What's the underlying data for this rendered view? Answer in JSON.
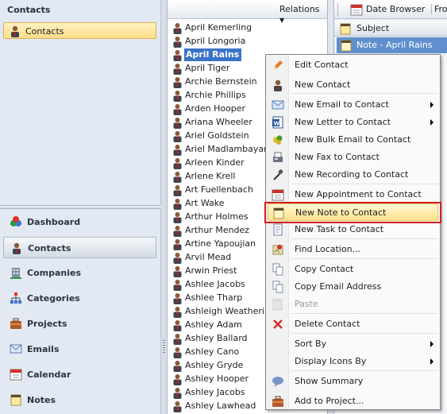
{
  "left_pane": {
    "title": "Contacts",
    "folder_label": "Contacts",
    "nav": [
      {
        "label": "Dashboard",
        "icon": "dashboard-icon"
      },
      {
        "label": "Contacts",
        "icon": "contact-icon"
      },
      {
        "label": "Companies",
        "icon": "company-icon"
      },
      {
        "label": "Categories",
        "icon": "categories-icon"
      },
      {
        "label": "Projects",
        "icon": "projects-icon"
      },
      {
        "label": "Emails",
        "icon": "email-icon"
      },
      {
        "label": "Calendar",
        "icon": "calendar-icon"
      },
      {
        "label": "Notes",
        "icon": "notes-icon"
      }
    ]
  },
  "list_pane": {
    "relations_label": "Relations",
    "contacts": [
      "April Kemerling",
      "April Longoria",
      "April Rains",
      "April Tiger",
      "Archie Bernstein",
      "Archie Phillips",
      "Arden Hooper",
      "Ariana Wheeler",
      "Ariel Goldstein",
      "Ariel Madlambayan",
      "Arleen Kinder",
      "Arlene Krell",
      "Art Fuellenbach",
      "Art Wake",
      "Arthur Holmes",
      "Arthur Mendez",
      "Artine Yapoujian",
      "Arvil Mead",
      "Arwin Priest",
      "Ashlee Jacobs",
      "Ashlee Tharp",
      "Ashleigh Weatherill",
      "Ashley Adam",
      "Ashley Ballard",
      "Ashley Cano",
      "Ashley Gryde",
      "Ashley Hooper",
      "Ashley Jacobs",
      "Ashley Lawhead"
    ],
    "selected_contact": "April Rains"
  },
  "right_pane": {
    "date_browser_label": "Date Browser",
    "from_label": "Fro",
    "subject_header": "Subject",
    "note_row": "Note - April Rains"
  },
  "context_menu": {
    "items": [
      {
        "label": "Edit Contact",
        "icon": "pencil-icon"
      },
      {
        "label": "New Contact",
        "icon": "contact-icon"
      },
      {
        "label": "New Email to Contact",
        "icon": "email-icon",
        "submenu": true
      },
      {
        "label": "New Letter to Contact",
        "icon": "word-icon",
        "submenu": true
      },
      {
        "label": "New Bulk Email to Contact",
        "icon": "bulk-email-icon"
      },
      {
        "label": "New Fax to Contact",
        "icon": "fax-icon"
      },
      {
        "label": "New Recording to Contact",
        "icon": "microphone-icon"
      },
      {
        "label": "New Appointment to Contact",
        "icon": "calendar-icon"
      },
      {
        "label": "New Note to Contact",
        "icon": "note-icon",
        "highlighted": true
      },
      {
        "label": "New Task to Contact",
        "icon": "task-icon"
      },
      {
        "label": "Find Location...",
        "icon": "map-icon"
      },
      {
        "label": "Copy Contact",
        "icon": "copy-icon"
      },
      {
        "label": "Copy Email Address",
        "icon": "copy-icon"
      },
      {
        "label": "Paste",
        "icon": "paste-icon",
        "disabled": true
      },
      {
        "label": "Delete Contact",
        "icon": "delete-icon"
      },
      {
        "label": "Sort By",
        "submenu": true
      },
      {
        "label": "Display Icons By",
        "submenu": true
      },
      {
        "label": "Show Summary",
        "icon": "summary-icon"
      },
      {
        "label": "Add to Project...",
        "icon": "project-icon"
      }
    ]
  },
  "colors": {
    "selection_blue": "#3a74c9",
    "highlight_gold": "#ffe38d",
    "annotation_red": "#d11f1f"
  }
}
